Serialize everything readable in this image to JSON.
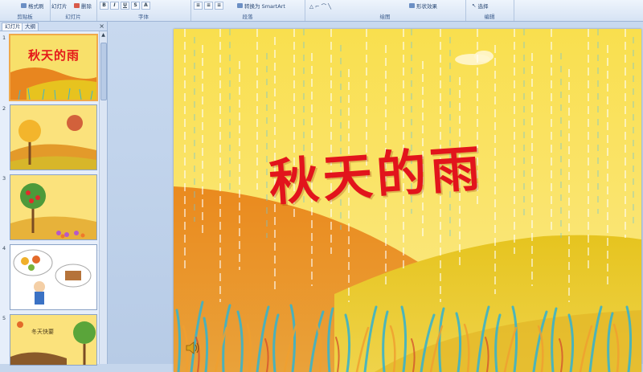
{
  "ribbon": {
    "groups": [
      {
        "id": "clipboard",
        "label": "剪贴板",
        "width": 62
      },
      {
        "id": "slides",
        "label": "幻灯片",
        "width": 58
      },
      {
        "id": "font",
        "label": "字体",
        "width": 117
      },
      {
        "id": "paragraph",
        "label": "段落",
        "width": 142
      },
      {
        "id": "drawing",
        "label": "绘图",
        "width": 200
      },
      {
        "id": "editing",
        "label": "编辑",
        "width": 60
      }
    ],
    "format_painter": "格式刷",
    "new_slide": "幻灯片",
    "delete": "删除",
    "convert_smartart": "转换为 SmartArt",
    "shape_effects": "形状效果",
    "select": "选择"
  },
  "pane": {
    "tab_slides": "幻灯片",
    "tab_outline": "大纲",
    "close": "×",
    "thumbnails": [
      {
        "num": "1",
        "title": "秋天的雨",
        "selected": true
      },
      {
        "num": "2",
        "title": "",
        "selected": false
      },
      {
        "num": "3",
        "title": "",
        "selected": false
      },
      {
        "num": "4",
        "title": "",
        "selected": false
      },
      {
        "num": "5",
        "title": "冬天快要",
        "selected": false
      }
    ]
  },
  "slide": {
    "title": "秋天的雨",
    "title_color": "#e2141c"
  },
  "colors": {
    "sky": "#f7e168",
    "hill_orange": "#e9871e",
    "hill_yellow": "#e6c21c",
    "grass": "#3bb3c9"
  }
}
